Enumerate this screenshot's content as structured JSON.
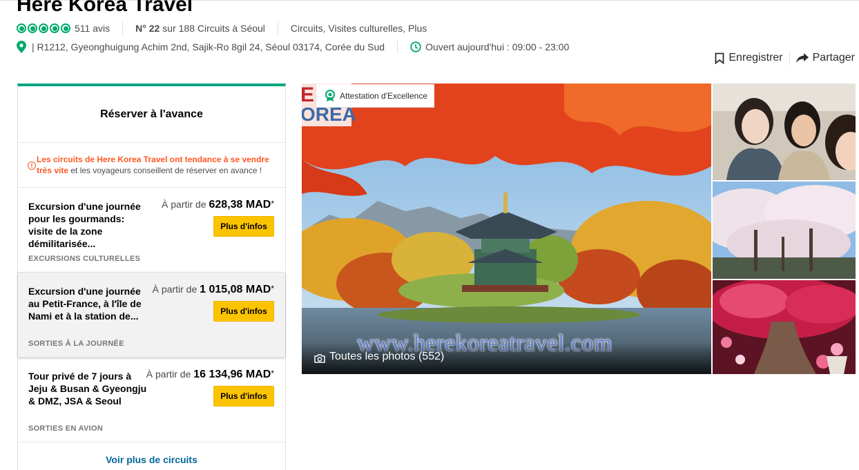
{
  "header": {
    "title": "Here Korea Travel",
    "rating_bubbles": 5,
    "reviews": "511 avis",
    "rank_number": "N° 22",
    "rank_text": "sur 188 Circuits à Séoul",
    "categories": "Circuits, Visites culturelles, Plus",
    "address": "| R1212, Gyeonghuigung Achim 2nd, Sajik-Ro 8gil 24, Séoul 03174, Corée du Sud",
    "hours": "Ouvert aujourd'hui : 09:00 - 23:00",
    "save_label": "Enregistrer",
    "share_label": "Partager"
  },
  "booking": {
    "title": "Réserver à l'avance",
    "notice_highlight": "Les circuits de Here Korea Travel ont tendance à se vendre très vite",
    "notice_rest": " et les voyageurs conseillent de réserver en avance !",
    "tours": [
      {
        "name": "Excursion d'une journée pour les gourmands: visite de la zone démilitarisée...",
        "price_prefix": "À partir de ",
        "price": "628,38 MAD",
        "star": "*",
        "button": "Plus d'infos",
        "category": "EXCURSIONS CULTURELLES"
      },
      {
        "name": "Excursion d'une journée au Petit-France, à l'île de Nami et à la station de...",
        "price_prefix": "À partir de ",
        "price": "1 015,08 MAD",
        "star": "*",
        "button": "Plus d'infos",
        "category": "SORTIES À LA JOURNÉE"
      },
      {
        "name": "Tour privé de 7 jours à Jeju & Busan & Gyeongju & DMZ, JSA & Seoul",
        "price_prefix": "À partir de ",
        "price": "16 134,96 MAD",
        "star": "*",
        "button": "Plus d'infos",
        "category": "SORTIES EN AVION"
      }
    ],
    "see_more": "Voir plus de circuits"
  },
  "gallery": {
    "badge": "Attestation d'Excellence",
    "logo_line1": "E",
    "logo_line2": "OREA",
    "watermark": "www.herekoreatravel.com",
    "all_photos": "Toutes les photos (552)"
  },
  "colors": {
    "brand_green": "#00aa6c",
    "panel_accent": "#00a680",
    "button_yellow": "#fcc400",
    "alert_orange": "#ff5722",
    "link_blue": "#006699"
  },
  "icons": [
    "map-pin-icon",
    "clock-icon",
    "bookmark-icon",
    "share-arrow-icon",
    "alert-icon",
    "award-icon",
    "camera-icon"
  ]
}
